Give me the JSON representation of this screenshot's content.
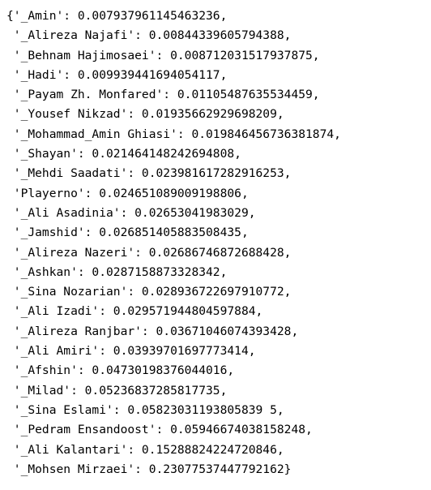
{
  "output": {
    "lines": [
      "{'_Amin': 0.007937961145463236,",
      " '_Alireza Najafi': 0.00844339605794388,",
      " '_Behnam Hajimosaei': 0.008712031517937875,",
      " '_Hadi': 0.009939441694054117,",
      " '_Payam Zh. Monfared': 0.01105487635534459,",
      " '_Yousef Nikzad': 0.01935662929698209,",
      " '_Mohammad_Amin Ghiasi': 0.019846456736381874,",
      " '_Shayan': 0.021464148242694808,",
      " '_Mehdi Saadati': 0.023981617282916253,",
      " 'Playerno': 0.024651089009198806,",
      " '_Ali Asadinia': 0.02653041983029,",
      " '_Jamshid': 0.026851405883508435,",
      " '_Alireza Nazeri': 0.02686746872688428,",
      " '_Ashkan': 0.0287158873328342,",
      " '_Sina Nozarian': 0.028936722697910772,",
      " '_Ali Izadi': 0.029571944804597884,",
      " '_Alireza Ranjbar': 0.03671046074393428,",
      " '_Ali Amiri': 0.03939701697773414,",
      " '_Afshin': 0.04730198376044016,",
      " '_Milad': 0.05236837285817735,",
      " '_Sina Eslami': 0.05823031193805839 5,",
      " '_Pedram Ensandoost': 0.05946674038158248,",
      " '_Ali Kalantari': 0.15288824224720846,",
      " '_Mohsen Mirzaei': 0.23077537447792162}"
    ]
  }
}
